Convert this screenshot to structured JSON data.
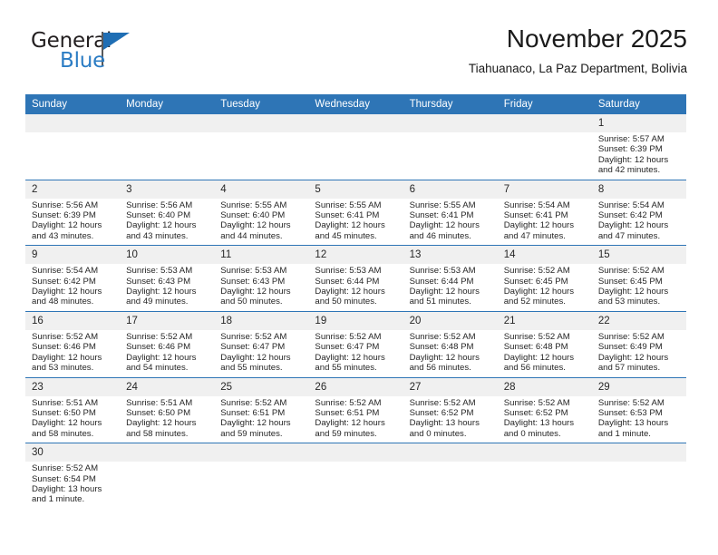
{
  "brand": {
    "name_primary": "General",
    "name_secondary": "Blue",
    "logo_icon": "blue-flag-triangle"
  },
  "header": {
    "title": "November 2025",
    "subtitle": "Tiahuanaco, La Paz Department, Bolivia"
  },
  "colors": {
    "header_blue": "#2e75b6",
    "daynum_band": "#f0f0f0",
    "logo_blue": "#2b7cc4",
    "text": "#262626"
  },
  "calendar": {
    "weekday_headers": [
      "Sunday",
      "Monday",
      "Tuesday",
      "Wednesday",
      "Thursday",
      "Friday",
      "Saturday"
    ],
    "labels": {
      "sunrise": "Sunrise:",
      "sunset": "Sunset:",
      "daylight": "Daylight:"
    },
    "weeks": [
      [
        {
          "blank": true
        },
        {
          "blank": true
        },
        {
          "blank": true
        },
        {
          "blank": true
        },
        {
          "blank": true
        },
        {
          "blank": true
        },
        {
          "day": "1",
          "sunrise": "Sunrise: 5:57 AM",
          "sunset": "Sunset: 6:39 PM",
          "daylight_1": "Daylight: 12 hours",
          "daylight_2": "and 42 minutes."
        }
      ],
      [
        {
          "day": "2",
          "sunrise": "Sunrise: 5:56 AM",
          "sunset": "Sunset: 6:39 PM",
          "daylight_1": "Daylight: 12 hours",
          "daylight_2": "and 43 minutes."
        },
        {
          "day": "3",
          "sunrise": "Sunrise: 5:56 AM",
          "sunset": "Sunset: 6:40 PM",
          "daylight_1": "Daylight: 12 hours",
          "daylight_2": "and 43 minutes."
        },
        {
          "day": "4",
          "sunrise": "Sunrise: 5:55 AM",
          "sunset": "Sunset: 6:40 PM",
          "daylight_1": "Daylight: 12 hours",
          "daylight_2": "and 44 minutes."
        },
        {
          "day": "5",
          "sunrise": "Sunrise: 5:55 AM",
          "sunset": "Sunset: 6:41 PM",
          "daylight_1": "Daylight: 12 hours",
          "daylight_2": "and 45 minutes."
        },
        {
          "day": "6",
          "sunrise": "Sunrise: 5:55 AM",
          "sunset": "Sunset: 6:41 PM",
          "daylight_1": "Daylight: 12 hours",
          "daylight_2": "and 46 minutes."
        },
        {
          "day": "7",
          "sunrise": "Sunrise: 5:54 AM",
          "sunset": "Sunset: 6:41 PM",
          "daylight_1": "Daylight: 12 hours",
          "daylight_2": "and 47 minutes."
        },
        {
          "day": "8",
          "sunrise": "Sunrise: 5:54 AM",
          "sunset": "Sunset: 6:42 PM",
          "daylight_1": "Daylight: 12 hours",
          "daylight_2": "and 47 minutes."
        }
      ],
      [
        {
          "day": "9",
          "sunrise": "Sunrise: 5:54 AM",
          "sunset": "Sunset: 6:42 PM",
          "daylight_1": "Daylight: 12 hours",
          "daylight_2": "and 48 minutes."
        },
        {
          "day": "10",
          "sunrise": "Sunrise: 5:53 AM",
          "sunset": "Sunset: 6:43 PM",
          "daylight_1": "Daylight: 12 hours",
          "daylight_2": "and 49 minutes."
        },
        {
          "day": "11",
          "sunrise": "Sunrise: 5:53 AM",
          "sunset": "Sunset: 6:43 PM",
          "daylight_1": "Daylight: 12 hours",
          "daylight_2": "and 50 minutes."
        },
        {
          "day": "12",
          "sunrise": "Sunrise: 5:53 AM",
          "sunset": "Sunset: 6:44 PM",
          "daylight_1": "Daylight: 12 hours",
          "daylight_2": "and 50 minutes."
        },
        {
          "day": "13",
          "sunrise": "Sunrise: 5:53 AM",
          "sunset": "Sunset: 6:44 PM",
          "daylight_1": "Daylight: 12 hours",
          "daylight_2": "and 51 minutes."
        },
        {
          "day": "14",
          "sunrise": "Sunrise: 5:52 AM",
          "sunset": "Sunset: 6:45 PM",
          "daylight_1": "Daylight: 12 hours",
          "daylight_2": "and 52 minutes."
        },
        {
          "day": "15",
          "sunrise": "Sunrise: 5:52 AM",
          "sunset": "Sunset: 6:45 PM",
          "daylight_1": "Daylight: 12 hours",
          "daylight_2": "and 53 minutes."
        }
      ],
      [
        {
          "day": "16",
          "sunrise": "Sunrise: 5:52 AM",
          "sunset": "Sunset: 6:46 PM",
          "daylight_1": "Daylight: 12 hours",
          "daylight_2": "and 53 minutes."
        },
        {
          "day": "17",
          "sunrise": "Sunrise: 5:52 AM",
          "sunset": "Sunset: 6:46 PM",
          "daylight_1": "Daylight: 12 hours",
          "daylight_2": "and 54 minutes."
        },
        {
          "day": "18",
          "sunrise": "Sunrise: 5:52 AM",
          "sunset": "Sunset: 6:47 PM",
          "daylight_1": "Daylight: 12 hours",
          "daylight_2": "and 55 minutes."
        },
        {
          "day": "19",
          "sunrise": "Sunrise: 5:52 AM",
          "sunset": "Sunset: 6:47 PM",
          "daylight_1": "Daylight: 12 hours",
          "daylight_2": "and 55 minutes."
        },
        {
          "day": "20",
          "sunrise": "Sunrise: 5:52 AM",
          "sunset": "Sunset: 6:48 PM",
          "daylight_1": "Daylight: 12 hours",
          "daylight_2": "and 56 minutes."
        },
        {
          "day": "21",
          "sunrise": "Sunrise: 5:52 AM",
          "sunset": "Sunset: 6:48 PM",
          "daylight_1": "Daylight: 12 hours",
          "daylight_2": "and 56 minutes."
        },
        {
          "day": "22",
          "sunrise": "Sunrise: 5:52 AM",
          "sunset": "Sunset: 6:49 PM",
          "daylight_1": "Daylight: 12 hours",
          "daylight_2": "and 57 minutes."
        }
      ],
      [
        {
          "day": "23",
          "sunrise": "Sunrise: 5:51 AM",
          "sunset": "Sunset: 6:50 PM",
          "daylight_1": "Daylight: 12 hours",
          "daylight_2": "and 58 minutes."
        },
        {
          "day": "24",
          "sunrise": "Sunrise: 5:51 AM",
          "sunset": "Sunset: 6:50 PM",
          "daylight_1": "Daylight: 12 hours",
          "daylight_2": "and 58 minutes."
        },
        {
          "day": "25",
          "sunrise": "Sunrise: 5:52 AM",
          "sunset": "Sunset: 6:51 PM",
          "daylight_1": "Daylight: 12 hours",
          "daylight_2": "and 59 minutes."
        },
        {
          "day": "26",
          "sunrise": "Sunrise: 5:52 AM",
          "sunset": "Sunset: 6:51 PM",
          "daylight_1": "Daylight: 12 hours",
          "daylight_2": "and 59 minutes."
        },
        {
          "day": "27",
          "sunrise": "Sunrise: 5:52 AM",
          "sunset": "Sunset: 6:52 PM",
          "daylight_1": "Daylight: 13 hours",
          "daylight_2": "and 0 minutes."
        },
        {
          "day": "28",
          "sunrise": "Sunrise: 5:52 AM",
          "sunset": "Sunset: 6:52 PM",
          "daylight_1": "Daylight: 13 hours",
          "daylight_2": "and 0 minutes."
        },
        {
          "day": "29",
          "sunrise": "Sunrise: 5:52 AM",
          "sunset": "Sunset: 6:53 PM",
          "daylight_1": "Daylight: 13 hours",
          "daylight_2": "and 1 minute."
        }
      ],
      [
        {
          "day": "30",
          "sunrise": "Sunrise: 5:52 AM",
          "sunset": "Sunset: 6:54 PM",
          "daylight_1": "Daylight: 13 hours",
          "daylight_2": "and 1 minute."
        },
        {
          "blank": true
        },
        {
          "blank": true
        },
        {
          "blank": true
        },
        {
          "blank": true
        },
        {
          "blank": true
        },
        {
          "blank": true
        }
      ]
    ]
  }
}
